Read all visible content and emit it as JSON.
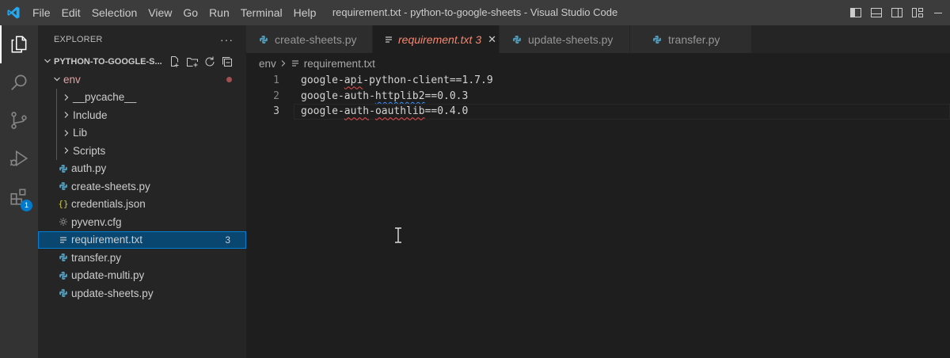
{
  "titlebar": {
    "menu": [
      "File",
      "Edit",
      "Selection",
      "View",
      "Go",
      "Run",
      "Terminal",
      "Help"
    ],
    "window_title": "requirement.txt - python-to-google-sheets - Visual Studio Code",
    "logo_icon": "vscode-logo-icon",
    "controls": [
      "toggle-sidebar-icon",
      "toggle-panel-icon",
      "toggle-secondary-sidebar-icon",
      "customize-layout-icon",
      "minimize-icon"
    ]
  },
  "activitybar": {
    "items": [
      "explorer-icon",
      "search-icon",
      "source-control-icon",
      "run-debug-icon",
      "extensions-icon"
    ],
    "extensions_badge": "1"
  },
  "sidebar": {
    "title": "EXPLORER",
    "more": "···",
    "section_title": "PYTHON-TO-GOOGLE-S...",
    "tree": {
      "env": "env",
      "pycache": "__pycache__",
      "include": "Include",
      "lib": "Lib",
      "scripts": "Scripts",
      "auth": "auth.py",
      "create_sheets": "create-sheets.py",
      "credentials": "credentials.json",
      "pyvenv": "pyvenv.cfg",
      "requirement": "requirement.txt",
      "requirement_count": "3",
      "transfer": "transfer.py",
      "update_multi": "update-multi.py",
      "update_sheets": "update-sheets.py"
    }
  },
  "editor": {
    "tabs": {
      "create_sheets": "create-sheets.py",
      "requirement": "requirement.txt",
      "requirement_count": "3",
      "update_sheets": "update-sheets.py",
      "transfer": "transfer.py",
      "close": "✕"
    },
    "breadcrumb": {
      "folder": "env",
      "file": "requirement.txt"
    },
    "lines": [
      {
        "n": "1",
        "pre": "google-",
        "sq": "api",
        "post": "-python-client==1.7.9"
      },
      {
        "n": "2",
        "pre": "google-auth-",
        "sq": "httplib2",
        "post": "==0.0.3"
      },
      {
        "n": "3",
        "pre": "google-",
        "sq": "auth",
        "mid": "-",
        "sq2": "oauthlib",
        "post": "==0.4.0"
      }
    ]
  },
  "colors": {
    "accent": "#007acc",
    "error": "#f48771",
    "python_icon": "#519aba",
    "json_icon": "#cbcb41"
  }
}
